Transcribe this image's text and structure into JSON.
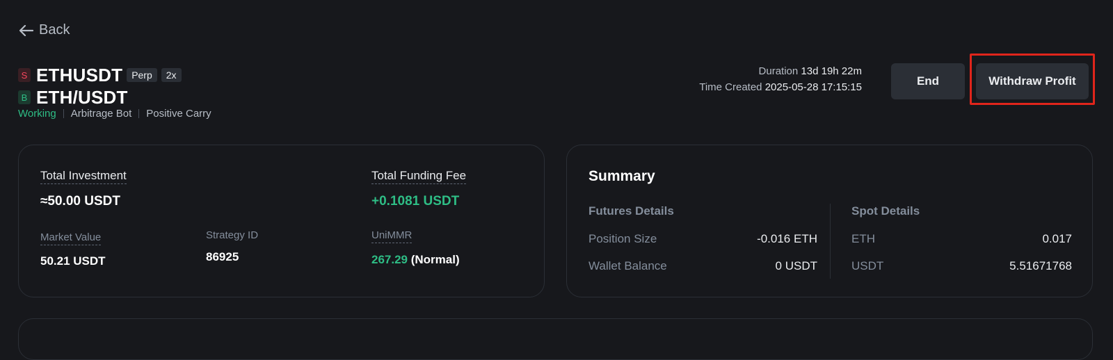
{
  "nav": {
    "back_label": "Back"
  },
  "header": {
    "short_side": "S",
    "long_side": "B",
    "perp_symbol": "ETHUSDT",
    "perp_tag": "Perp",
    "leverage_tag": "2x",
    "spot_symbol": "ETH/USDT",
    "status": "Working",
    "bot_type": "Arbitrage Bot",
    "strategy_type": "Positive Carry"
  },
  "timing": {
    "duration_label": "Duration",
    "duration_value": "13d 19h 22m",
    "created_label": "Time Created",
    "created_value": "2025-05-28 17:15:15"
  },
  "actions": {
    "end_label": "End",
    "withdraw_label": "Withdraw Profit"
  },
  "overview": {
    "total_investment_label": "Total Investment",
    "total_investment_value": "≈50.00 USDT",
    "total_funding_label": "Total Funding Fee",
    "total_funding_value": "+0.1081 USDT",
    "market_value_label": "Market Value",
    "market_value_value": "50.21 USDT",
    "strategy_id_label": "Strategy ID",
    "strategy_id_value": "86925",
    "unimmr_label": "UniMMR",
    "unimmr_value": "267.29",
    "unimmr_status": "(Normal)"
  },
  "summary": {
    "title": "Summary",
    "futures_title": "Futures Details",
    "position_size_label": "Position Size",
    "position_size_value": "-0.016 ETH",
    "wallet_balance_label": "Wallet Balance",
    "wallet_balance_value": "0 USDT",
    "spot_title": "Spot Details",
    "spot_eth_label": "ETH",
    "spot_eth_value": "0.017",
    "spot_usdt_label": "USDT",
    "spot_usdt_value": "5.51671768"
  },
  "colors": {
    "accent_green": "#2ebd85",
    "accent_red": "#f6465d",
    "highlight_red": "#e0251b"
  }
}
